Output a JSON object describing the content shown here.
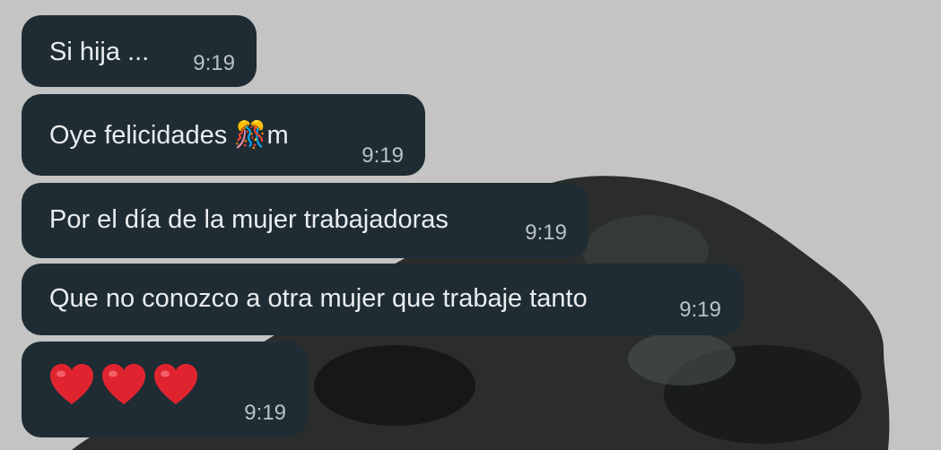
{
  "messages": [
    {
      "text": "Si hija ...",
      "time": "9:19"
    },
    {
      "text": "Oye felicidades ",
      "emoji_name": "confetti-ball-icon",
      "suffix": "m",
      "time": "9:19"
    },
    {
      "text": "Por el día de la mujer trabajadoras",
      "time": "9:19"
    },
    {
      "text": "Que no conozco a otra mujer que trabaje tanto",
      "time": "9:19"
    },
    {
      "hearts": [
        "red-heart-icon",
        "red-heart-icon",
        "red-heart-icon"
      ],
      "time": "9:19"
    }
  ],
  "colors": {
    "background": "#c4c4c4",
    "bubble": "#1f2c34",
    "text": "#e9edef",
    "time": "#b9c2c8",
    "heart": "#e0242f"
  }
}
